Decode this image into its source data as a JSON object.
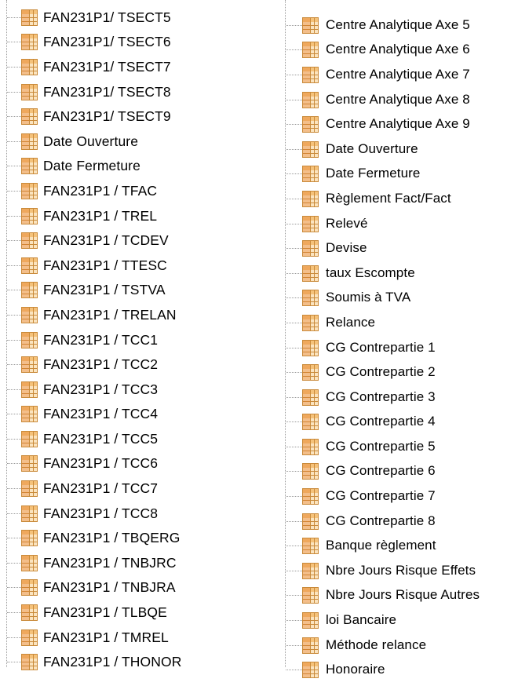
{
  "left_tree": [
    "FAN231P1/ TSECT5",
    "FAN231P1/ TSECT6",
    "FAN231P1/ TSECT7",
    "FAN231P1/ TSECT8",
    "FAN231P1/ TSECT9",
    "Date Ouverture",
    "Date Fermeture",
    "FAN231P1 / TFAC",
    "FAN231P1 / TREL",
    "FAN231P1 / TCDEV",
    " FAN231P1 / TTESC",
    "FAN231P1 / TSTVA",
    "FAN231P1 / TRELAN",
    "FAN231P1 / TCC1",
    "FAN231P1 / TCC2",
    "FAN231P1 / TCC3",
    "FAN231P1 / TCC4",
    "FAN231P1 / TCC5",
    "FAN231P1 / TCC6",
    "FAN231P1 / TCC7",
    "FAN231P1 / TCC8",
    "FAN231P1 / TBQERG",
    "FAN231P1 / TNBJRC",
    "FAN231P1 / TNBJRA",
    "FAN231P1 / TLBQE",
    "FAN231P1 / TMREL",
    "FAN231P1 / THONOR"
  ],
  "right_tree": [
    "Centre Analytique Axe 5",
    "Centre Analytique Axe 6",
    "Centre Analytique Axe 7",
    "Centre Analytique Axe 8",
    "Centre Analytique Axe 9",
    "Date Ouverture",
    "Date Fermeture",
    "Règlement Fact/Fact",
    "Relevé",
    "Devise",
    "taux Escompte",
    "Soumis à TVA",
    "Relance",
    "CG Contrepartie 1",
    "CG Contrepartie 2",
    "CG Contrepartie 3",
    "CG Contrepartie 4",
    "CG Contrepartie 5",
    "CG Contrepartie 6",
    "CG Contrepartie 7",
    "CG Contrepartie 8",
    "Banque règlement",
    "Nbre Jours Risque Effets",
    "Nbre Jours Risque Autres",
    "loi Bancaire",
    "Méthode relance",
    "Honoraire"
  ],
  "icon": "table-field-icon",
  "colors": {
    "icon_border": "#c98a3a",
    "icon_fill": "#fbe4bf",
    "connector": "#9a9a9a"
  }
}
